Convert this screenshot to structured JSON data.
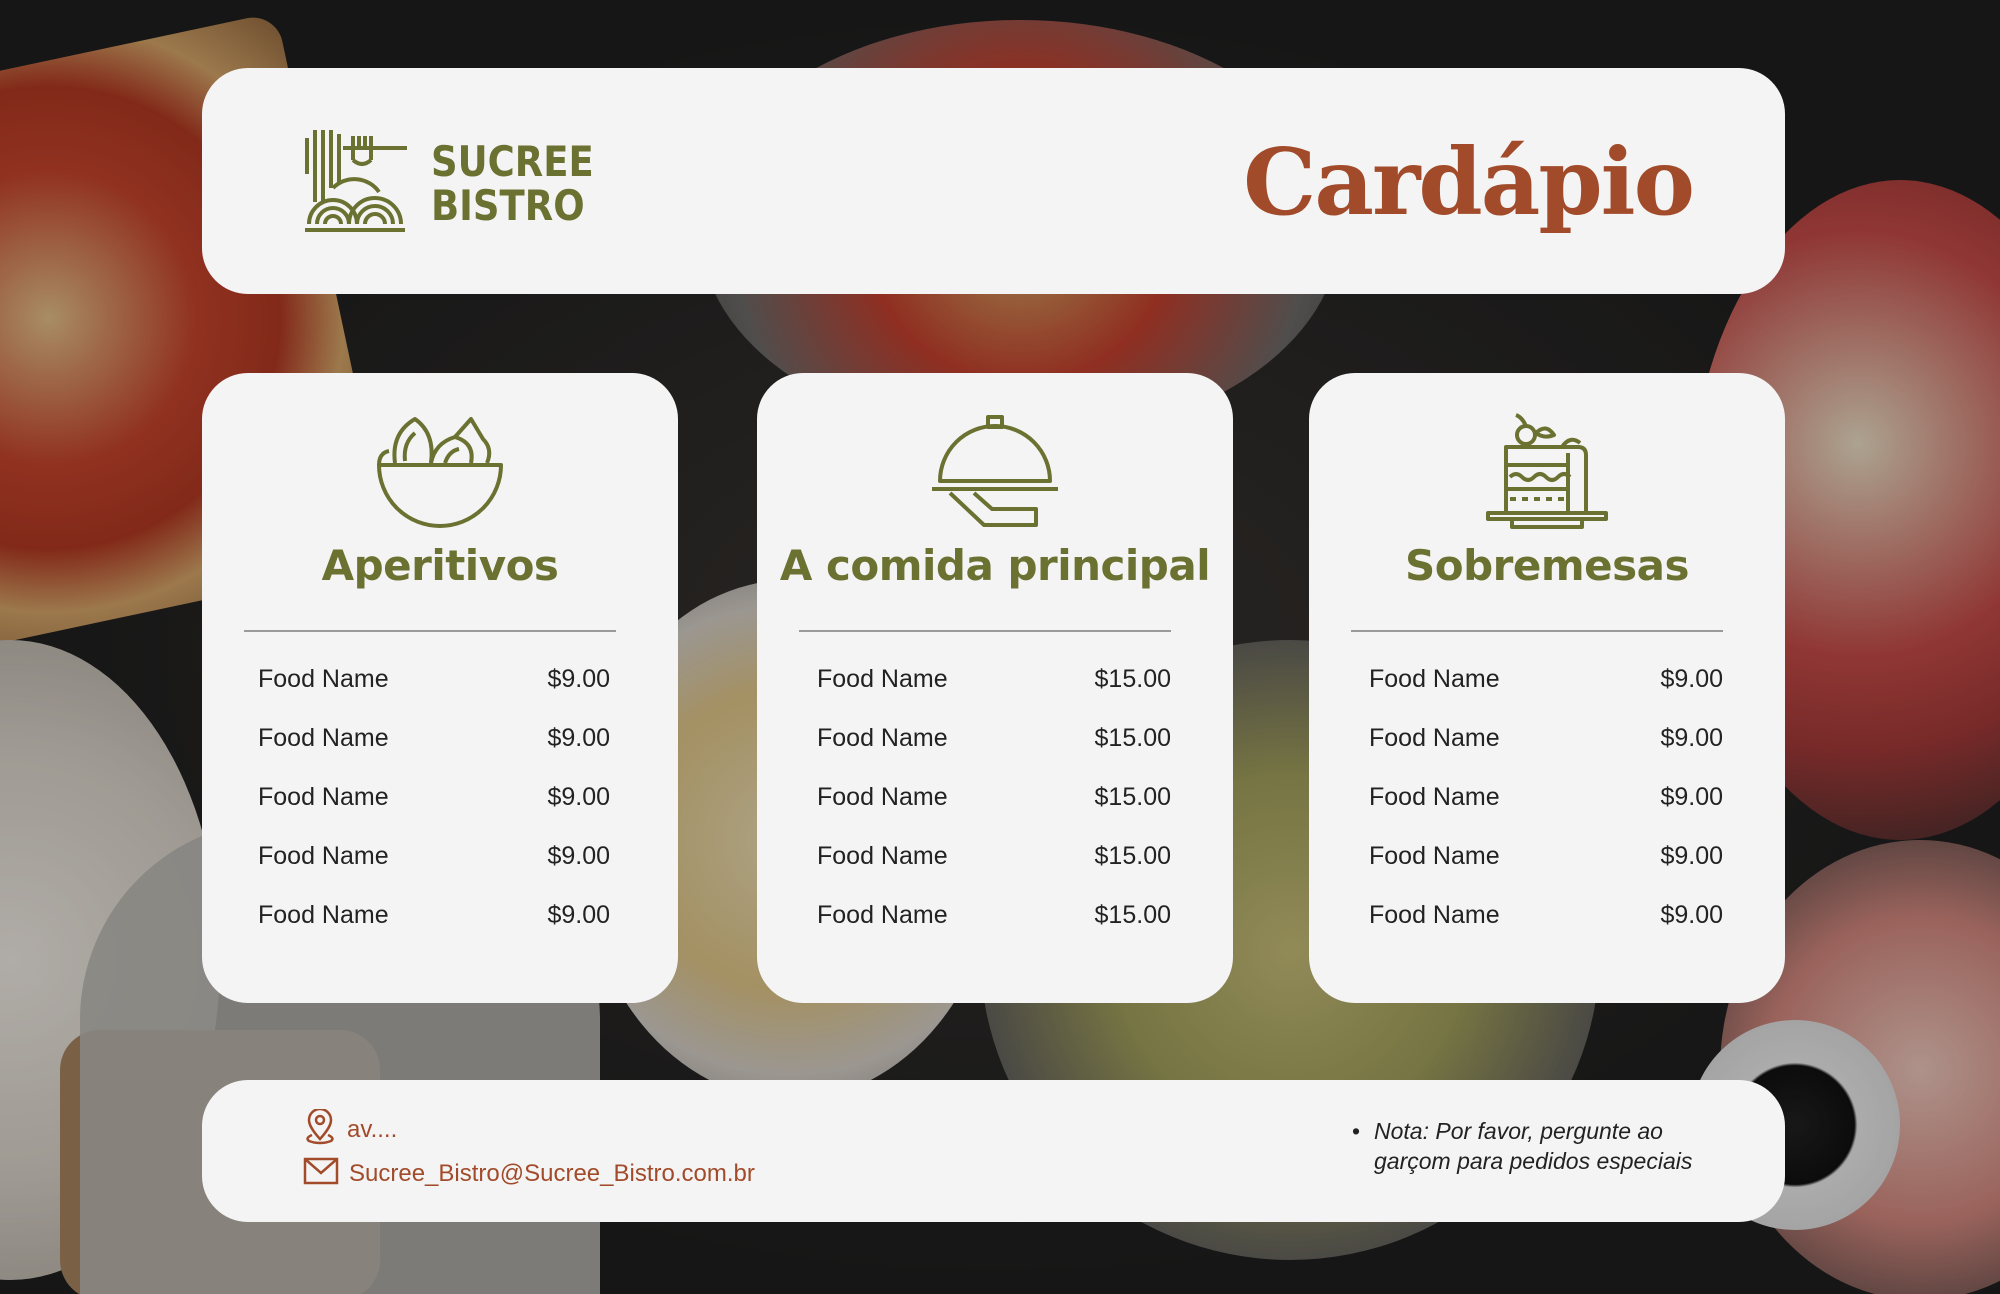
{
  "brand": {
    "name_line1": "SUCREE",
    "name_line2": "BISTRO",
    "logo_icon": "pasta-fork-icon",
    "olive_color": "#6b7131"
  },
  "page_title": "Cardápio",
  "accent_color": "#a24b2b",
  "sections": [
    {
      "icon": "salad-bowl-icon",
      "title": "Aperitivos",
      "items": [
        {
          "name": "Food Name",
          "price": "$9.00"
        },
        {
          "name": "Food Name",
          "price": "$9.00"
        },
        {
          "name": "Food Name",
          "price": "$9.00"
        },
        {
          "name": "Food Name",
          "price": "$9.00"
        },
        {
          "name": "Food Name",
          "price": "$9.00"
        }
      ]
    },
    {
      "icon": "cloche-serving-icon",
      "title": "A comida principal",
      "items": [
        {
          "name": "Food Name",
          "price": "$15.00"
        },
        {
          "name": "Food Name",
          "price": "$15.00"
        },
        {
          "name": "Food Name",
          "price": "$15.00"
        },
        {
          "name": "Food Name",
          "price": "$15.00"
        },
        {
          "name": "Food Name",
          "price": "$15.00"
        }
      ]
    },
    {
      "icon": "cake-icon",
      "title": "Sobremesas",
      "items": [
        {
          "name": "Food Name",
          "price": "$9.00"
        },
        {
          "name": "Food Name",
          "price": "$9.00"
        },
        {
          "name": "Food Name",
          "price": "$9.00"
        },
        {
          "name": "Food Name",
          "price": "$9.00"
        },
        {
          "name": "Food Name",
          "price": "$9.00"
        }
      ]
    }
  ],
  "footer": {
    "address": "av....",
    "address_icon": "location-pin-icon",
    "email": "Sucree_Bistro@Sucree_Bistro.com.br",
    "email_icon": "envelope-icon",
    "note": "Nota: Por favor, pergunte ao garçom para pedidos especiais"
  }
}
